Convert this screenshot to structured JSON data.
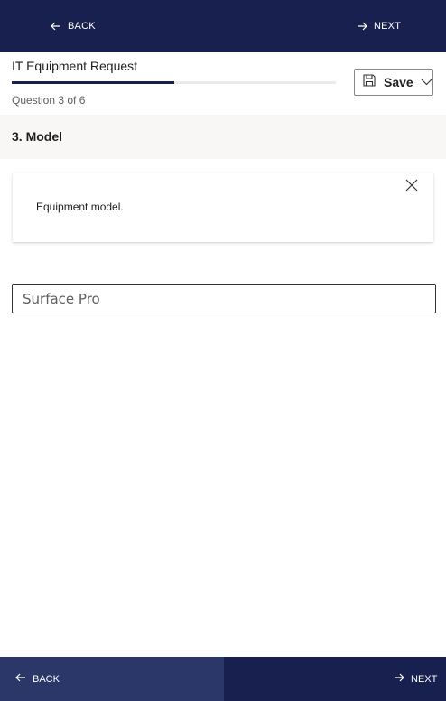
{
  "nav": {
    "back_label": "BACK",
    "next_label": "NEXT"
  },
  "form": {
    "title": "IT Equipment Request",
    "question_counter": "Question 3 of 6",
    "progress": 0.5,
    "save_label": "Save"
  },
  "question": {
    "heading": "3. Model",
    "description": "Equipment model.",
    "answer_value": "Surface Pro"
  },
  "colors": {
    "nav_bar": "#17204e",
    "nav_back_bottom": "#2a3768",
    "section_bg": "#f8f7f5"
  },
  "icons": {
    "back": "arrow-left-icon",
    "next": "arrow-right-icon",
    "save": "floppy-disk-icon",
    "dropdown": "chevron-down-icon",
    "close": "close-icon"
  }
}
